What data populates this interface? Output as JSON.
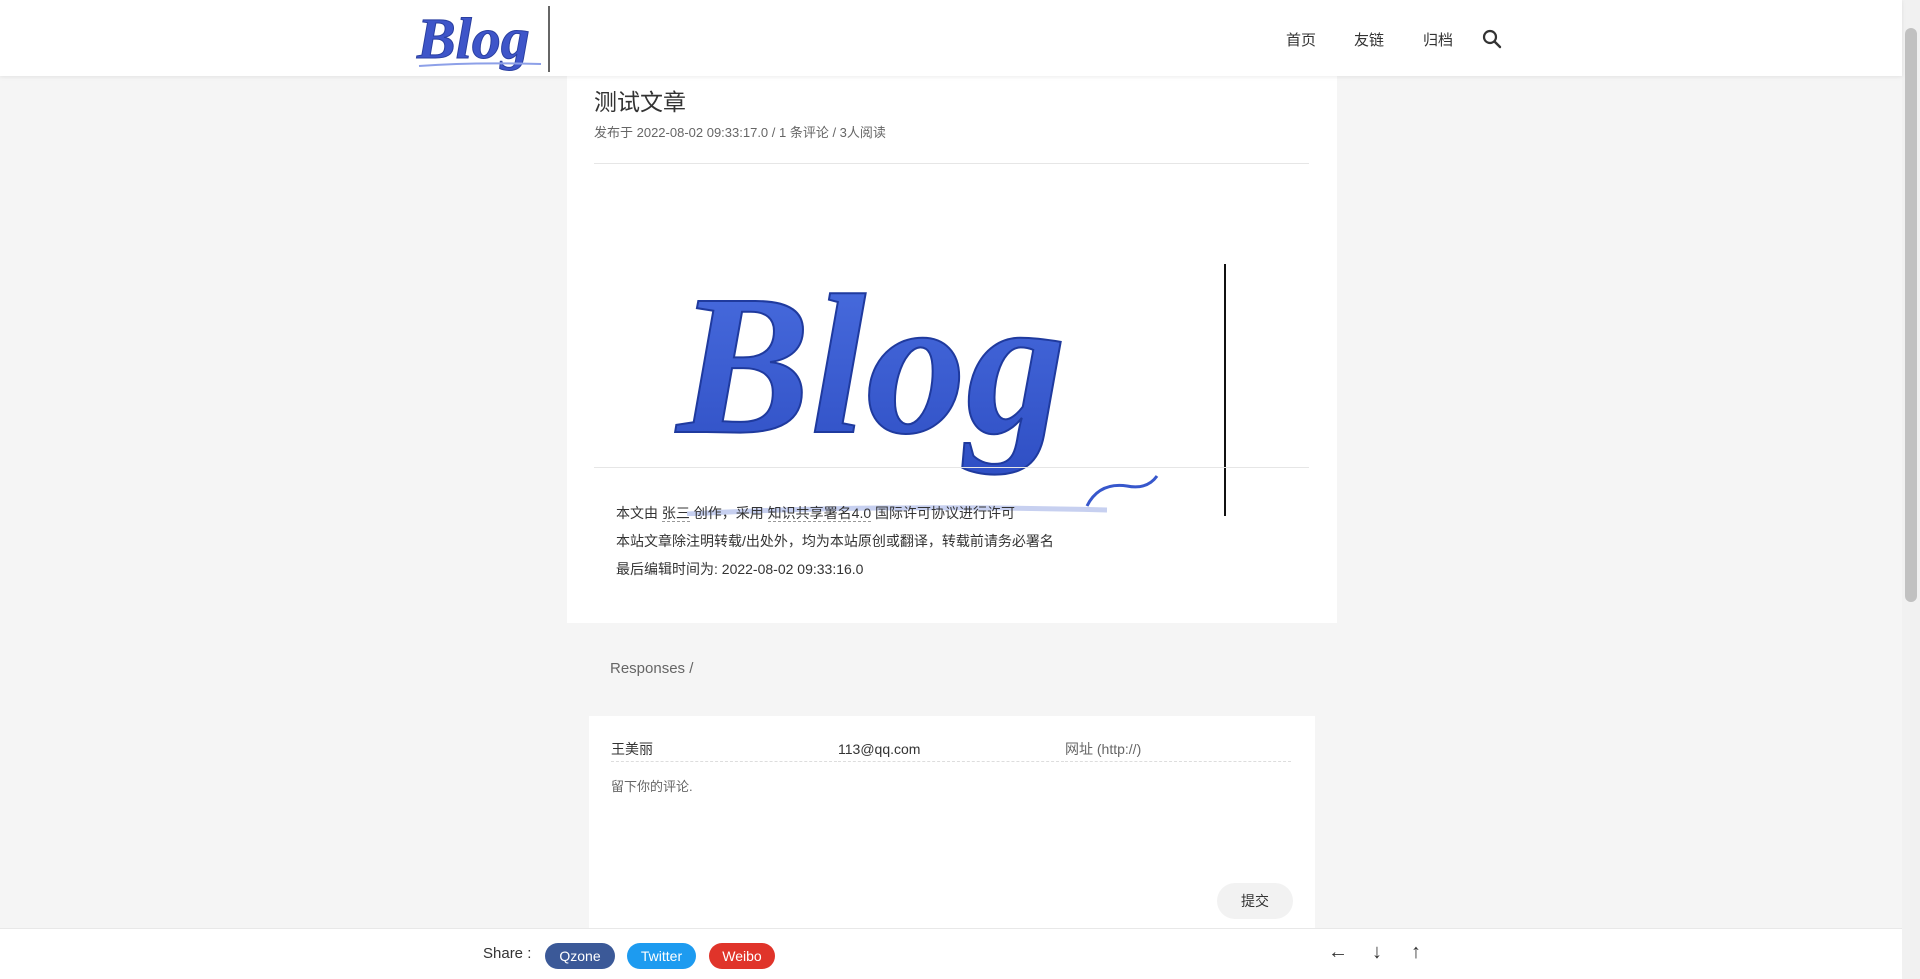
{
  "header": {
    "logo_text": "Blog",
    "nav": [
      "首页",
      "友链",
      "归档"
    ]
  },
  "article": {
    "title": "测试文章",
    "meta": "发布于 2022-08-02 09:33:17.0 / 1 条评论 / 3人阅读",
    "image_text": "Blog",
    "copyright": {
      "prefix": "本文由",
      "author": "张三",
      "middle": "创作，采用",
      "license": "知识共享署名4.0",
      "suffix": "国际许可协议进行许可",
      "line2": "本站文章除注明转载/出处外，均为本站原创或翻译，转载前请务必署名",
      "line3": "最后编辑时间为: 2022-08-02 09:33:16.0"
    }
  },
  "responses": {
    "label": "Responses /"
  },
  "comment_form": {
    "name_value": "王美丽",
    "email_value": "113@qq.com",
    "url_placeholder": "网址 (http://)",
    "comment_placeholder": "留下你的评论.",
    "submit_label": "提交"
  },
  "footer": {
    "share_label": "Share :",
    "share_buttons": [
      {
        "label": "Qzone",
        "color": "#3b5998"
      },
      {
        "label": "Twitter",
        "color": "#1d9bf0"
      },
      {
        "label": "Weibo",
        "color": "#e0342a"
      }
    ],
    "arrows": [
      "←",
      "↓",
      "↑"
    ]
  }
}
